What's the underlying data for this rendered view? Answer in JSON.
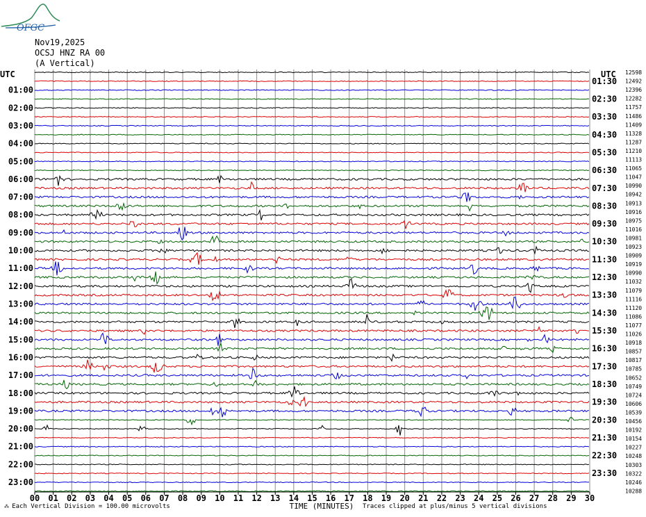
{
  "header": {
    "logo_text": "OFGC",
    "date": "Nov19,2025",
    "station": "OCSJ HNZ RA 00",
    "component": "(A Vertical)"
  },
  "footer": {
    "left_note": "Each Vertical Division =  100.00 microvolts",
    "right_note": "Traces clipped at plus/minus 5 vertical divisions"
  },
  "chart_data": {
    "type": "line",
    "title": "",
    "xlabel": "TIME (MINUTES)",
    "ylabel": "",
    "left_axis_title": "UTC",
    "right_axis_title": "UTC",
    "xlim": [
      0,
      30
    ],
    "x_ticks": [
      "00",
      "01",
      "02",
      "03",
      "04",
      "05",
      "06",
      "07",
      "08",
      "09",
      "10",
      "11",
      "12",
      "13",
      "14",
      "15",
      "16",
      "17",
      "18",
      "19",
      "20",
      "21",
      "22",
      "23",
      "24",
      "25",
      "26",
      "27",
      "28",
      "29",
      "30"
    ],
    "left_hour_labels": [
      "01:00",
      "02:00",
      "03:00",
      "04:00",
      "05:00",
      "06:00",
      "07:00",
      "08:00",
      "09:00",
      "10:00",
      "11:00",
      "12:00",
      "13:00",
      "14:00",
      "15:00",
      "16:00",
      "17:00",
      "18:00",
      "19:00",
      "20:00",
      "21:00",
      "22:00",
      "23:00"
    ],
    "right_half_hour_labels": [
      "01:30",
      "02:30",
      "03:30",
      "04:30",
      "05:30",
      "06:30",
      "07:30",
      "08:30",
      "09:30",
      "10:30",
      "11:30",
      "12:30",
      "13:30",
      "14:30",
      "15:30",
      "16:30",
      "17:30",
      "18:30",
      "19:30",
      "20:30",
      "21:30",
      "22:30",
      "23:30"
    ],
    "trace_count": 48,
    "trace_colors": [
      "#000000",
      "#dd0000",
      "#0000dd",
      "#006400"
    ],
    "trace_values": [
      12598,
      12492,
      12396,
      12282,
      11757,
      11486,
      11409,
      11328,
      11287,
      11210,
      11113,
      11065,
      11047,
      10990,
      10942,
      10913,
      10916,
      10975,
      11016,
      10981,
      10923,
      10909,
      10919,
      10990,
      11032,
      11079,
      11116,
      11120,
      11086,
      11077,
      11026,
      10918,
      10857,
      10817,
      10785,
      10652,
      10749,
      10724,
      10606,
      10539,
      10456,
      10192,
      10154,
      10227,
      10248,
      10303,
      10322,
      10246,
      10288
    ],
    "grid": true
  }
}
